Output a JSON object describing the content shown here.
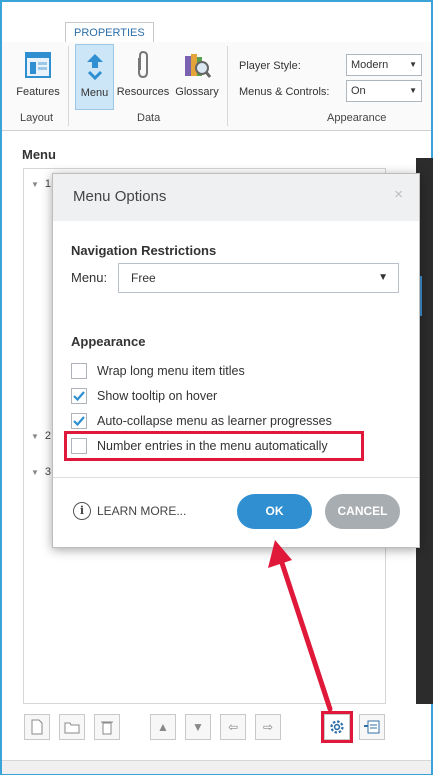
{
  "ribbon": {
    "tab_label": "PROPERTIES",
    "buttons": {
      "features": "Features",
      "menu": "Menu",
      "resources": "Resources",
      "glossary": "Glossary"
    },
    "groups": {
      "layout": "Layout",
      "data": "Data",
      "appearance": "Appearance"
    },
    "player_style_label": "Player Style:",
    "player_style_value": "Modern",
    "menus_controls_label": "Menus & Controls:",
    "menus_controls_value": "On"
  },
  "panel": {
    "title": "Menu",
    "tree_items": [
      "1",
      "2",
      "3"
    ]
  },
  "dialog": {
    "title": "Menu Options",
    "close_glyph": "×",
    "nav_restrictions_title": "Navigation Restrictions",
    "menu_label": "Menu:",
    "menu_value": "Free",
    "appearance_title": "Appearance",
    "options": [
      {
        "label": "Wrap long menu item titles",
        "checked": false
      },
      {
        "label": "Show tooltip on hover",
        "checked": true
      },
      {
        "label": "Auto-collapse menu as learner progresses",
        "checked": true
      },
      {
        "label": "Number entries in the menu automatically",
        "checked": false
      }
    ],
    "learn_more": "LEARN MORE...",
    "ok": "OK",
    "cancel": "CANCEL"
  },
  "colors": {
    "accent": "#2f8fd1",
    "highlight": "#e0183a",
    "frame": "#3aa4d8",
    "cancel": "#a8adb1"
  }
}
